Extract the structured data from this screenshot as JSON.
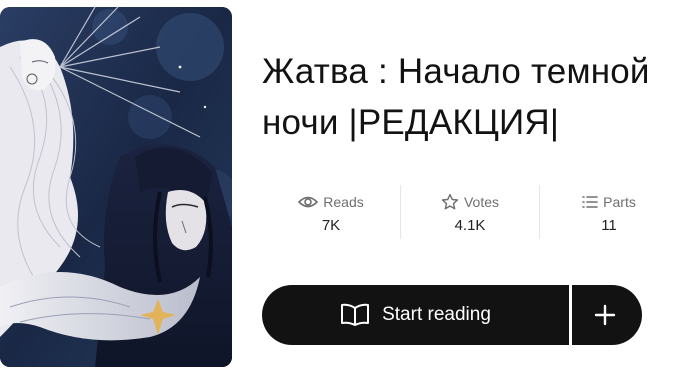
{
  "story": {
    "title_line1": "Жатва : Начало темной",
    "title_line2": "ночи |РЕДАКЦИЯ|"
  },
  "stats": {
    "reads": {
      "label": "Reads",
      "value": "7K",
      "icon": "eye-icon"
    },
    "votes": {
      "label": "Votes",
      "value": "4.1K",
      "icon": "star-icon"
    },
    "parts": {
      "label": "Parts",
      "value": "11",
      "icon": "list-icon"
    }
  },
  "actions": {
    "start_reading_label": "Start reading",
    "start_reading_icon": "open-book-icon",
    "add_icon": "plus-icon"
  },
  "colors": {
    "button_bg": "#121212",
    "button_text": "#ffffff",
    "stat_label": "#6f6f6f",
    "title_text": "#121212",
    "cover_night_blue": "#1c2b4a"
  }
}
